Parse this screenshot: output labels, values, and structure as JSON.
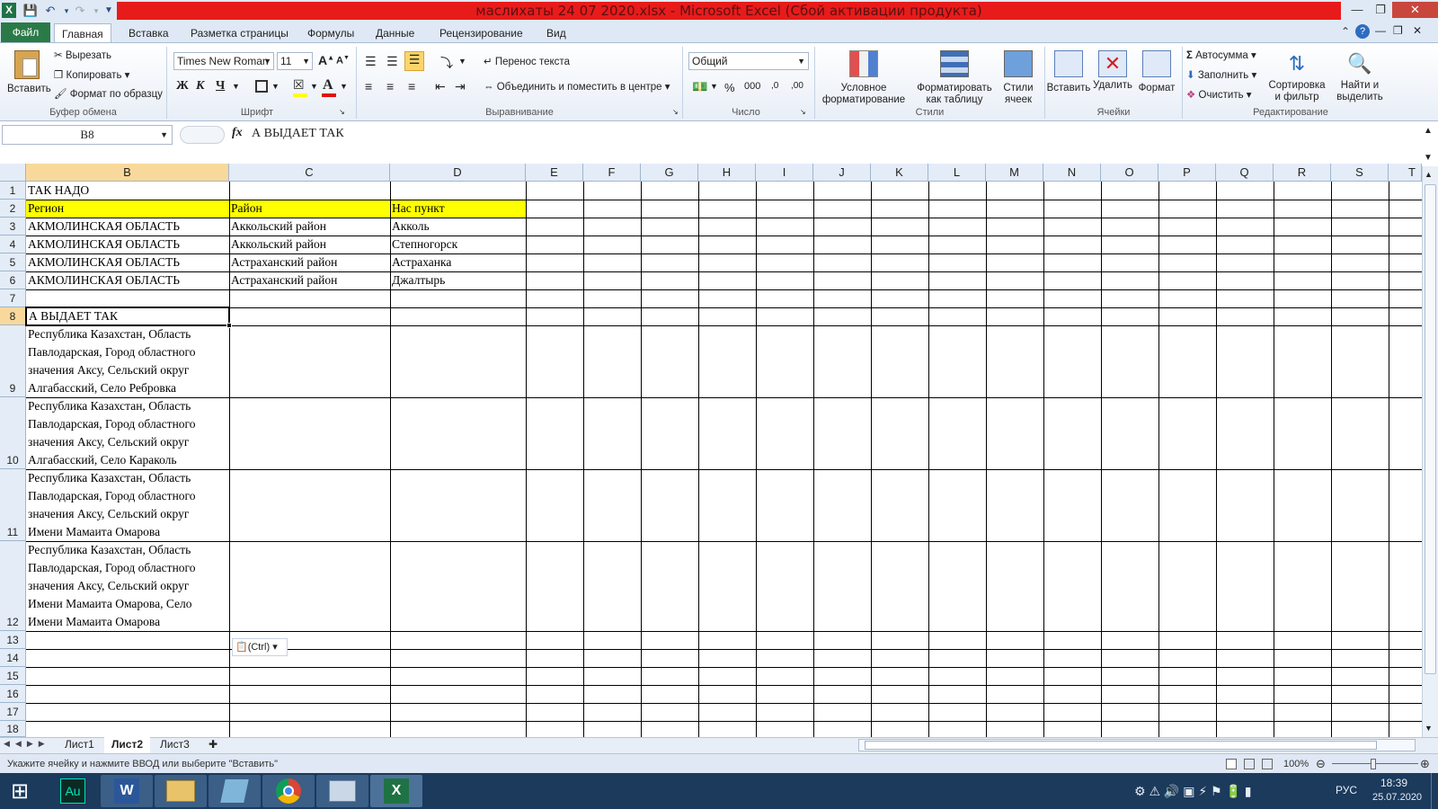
{
  "window": {
    "title": "маслихаты 24 07 2020.xlsx  -  Microsoft Excel (Сбой активации продукта)"
  },
  "ribbon_tabs": [
    "Файл",
    "Главная",
    "Вставка",
    "Разметка страницы",
    "Формулы",
    "Данные",
    "Рецензирование",
    "Вид"
  ],
  "clipboard": {
    "paste": "Вставить",
    "cut": "Вырезать",
    "copy": "Копировать",
    "format_painter": "Формат по образцу",
    "group": "Буфер обмена"
  },
  "font": {
    "name": "Times New Roman",
    "size": "11",
    "group": "Шрифт",
    "bold": "Ж",
    "italic": "К",
    "underline": "Ч",
    "grow": "A",
    "shrink": "A",
    "color_letter": "A"
  },
  "alignment": {
    "wrap": "Перенос текста",
    "merge": "Объединить и поместить в центре",
    "group": "Выравнивание"
  },
  "number": {
    "format": "Общий",
    "group": "Число",
    "percent": "%",
    "thousands": "000",
    "inc_decimal": ",0",
    "dec_decimal": ",00"
  },
  "styles": {
    "conditional": "Условное форматирование",
    "as_table": "Форматировать как таблицу",
    "cell_styles": "Стили ячеек",
    "group": "Стили"
  },
  "cells": {
    "insert": "Вставить",
    "delete": "Удалить",
    "format": "Формат",
    "group": "Ячейки"
  },
  "editing": {
    "autosum": "Автосумма",
    "fill": "Заполнить",
    "clear": "Очистить",
    "sort": "Сортировка и фильтр",
    "find": "Найти и выделить",
    "group": "Редактирование"
  },
  "formula_bar": {
    "name_box": "B8",
    "fx": "fx",
    "content": "А ВЫДАЕТ ТАК"
  },
  "columns": [
    "B",
    "C",
    "D",
    "E",
    "F",
    "G",
    "H",
    "I",
    "J",
    "K",
    "L",
    "M",
    "N",
    "O",
    "P",
    "Q",
    "R",
    "S",
    "T"
  ],
  "rows": [
    "1",
    "2",
    "3",
    "4",
    "5",
    "6",
    "7",
    "8",
    "9",
    "10",
    "11",
    "12",
    "13",
    "14",
    "15",
    "16",
    "17",
    "18"
  ],
  "cells_data": {
    "B1": "ТАК НАДО",
    "B2": "Регион",
    "C2": "Район",
    "D2": "Нас пункт",
    "B3": "АКМОЛИНСКАЯ ОБЛАСТЬ",
    "C3": "Аккольский район",
    "D3": "Акколь",
    "B4": "АКМОЛИНСКАЯ ОБЛАСТЬ",
    "C4": "Аккольский район",
    "D4": "Степногорск",
    "B5": "АКМОЛИНСКАЯ ОБЛАСТЬ",
    "C5": "Астраханский район",
    "D5": "Астраханка",
    "B6": "АКМОЛИНСКАЯ ОБЛАСТЬ",
    "C6": "Астраханский район",
    "D6": "Джалтырь",
    "B8": "А ВЫДАЕТ ТАК",
    "B9": [
      "Республика Казахстан, Область",
      "Павлодарская, Город областного",
      "значения Аксу, Сельский округ",
      "Алгабасский, Село Ребровка"
    ],
    "B10": [
      "Республика Казахстан, Область",
      "Павлодарская, Город областного",
      "значения Аксу, Сельский округ",
      "Алгабасский, Село Караколь"
    ],
    "B11": [
      "Республика Казахстан, Область",
      "Павлодарская, Город областного",
      "значения Аксу, Сельский округ",
      "Имени Мамаита Омарова"
    ],
    "B12": [
      "Республика Казахстан, Область",
      "Павлодарская, Город областного",
      "значения Аксу, Сельский округ",
      "Имени Мамаита Омарова, Село",
      "Имени Мамаита Омарова"
    ]
  },
  "paste_options": "(Ctrl)",
  "sheets": [
    "Лист1",
    "Лист2",
    "Лист3"
  ],
  "active_sheet": "Лист2",
  "status": {
    "message": "Укажите ячейку и нажмите ВВОД или выберите \"Вставить\"",
    "zoom": "100%"
  },
  "taskbar": {
    "apps": [
      "Au",
      "W",
      "folder",
      "notes",
      "chrome",
      "paint",
      "excel"
    ],
    "lang": "РУС",
    "time": "18:39",
    "date": "25.07.2020"
  },
  "colors": {
    "accent_green": "#2a7a48",
    "selection_header": "#f9d99b",
    "highlight_yellow": "#ffff00",
    "title_bar_red": "#e81b1b"
  }
}
